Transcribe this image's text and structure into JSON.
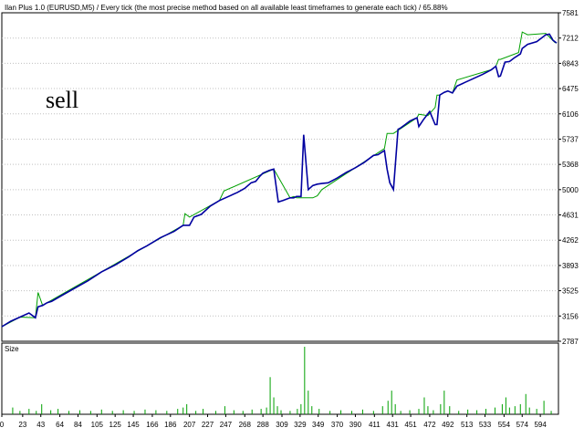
{
  "header": {
    "title": "Ilan Plus 1.0 (EURUSD,M5) / Every tick (the most precise method based on all available least timeframes to generate each tick) / 65.88%"
  },
  "overlay": {
    "label": "sell"
  },
  "size_panel": {
    "label": "Size"
  },
  "colors": {
    "balance": "#0000A0",
    "equity": "#00A000",
    "volume": "#00A000",
    "grid": "#C0C0C0"
  },
  "chart_data": [
    {
      "type": "line",
      "title": "",
      "xlabel": "",
      "ylabel": "",
      "y_ticks": [
        7581,
        7212,
        6843,
        6475,
        6106,
        5737,
        5368,
        5000,
        4631,
        4262,
        3893,
        3525,
        3156,
        2787
      ],
      "ylim": [
        2787,
        7581
      ],
      "xlim": [
        0,
        614
      ],
      "grid": true,
      "series": [
        {
          "role": "balance",
          "x": [
            0,
            10,
            20,
            30,
            37,
            40,
            45,
            50,
            55,
            64,
            80,
            95,
            110,
            125,
            140,
            150,
            160,
            175,
            190,
            200,
            207,
            212,
            220,
            230,
            240,
            250,
            260,
            268,
            275,
            280,
            285,
            288,
            295,
            300,
            305,
            310,
            318,
            322,
            325,
            330,
            333,
            338,
            343,
            348,
            353,
            360,
            370,
            380,
            390,
            400,
            410,
            415,
            422,
            425,
            428,
            432,
            437,
            440,
            445,
            450,
            458,
            460,
            465,
            472,
            478,
            480,
            483,
            488,
            492,
            497,
            502,
            510,
            520,
            530,
            540,
            545,
            548,
            550,
            555,
            560,
            565,
            572,
            574,
            580,
            590,
            600,
            604,
            608,
            612
          ],
          "y": [
            3000,
            3080,
            3140,
            3200,
            3130,
            3290,
            3310,
            3350,
            3370,
            3440,
            3560,
            3670,
            3800,
            3900,
            4020,
            4110,
            4180,
            4300,
            4390,
            4480,
            4480,
            4600,
            4640,
            4760,
            4840,
            4900,
            4960,
            5020,
            5100,
            5120,
            5200,
            5240,
            5280,
            5300,
            4820,
            4840,
            4880,
            4880,
            4900,
            4900,
            5800,
            5000,
            5060,
            5080,
            5090,
            5100,
            5170,
            5250,
            5320,
            5400,
            5500,
            5510,
            5570,
            5300,
            5100,
            5000,
            5880,
            5900,
            5950,
            6000,
            6050,
            5920,
            6020,
            6140,
            5950,
            5950,
            6380,
            6420,
            6440,
            6410,
            6510,
            6560,
            6620,
            6680,
            6750,
            6800,
            6650,
            6660,
            6860,
            6870,
            6920,
            6980,
            7060,
            7120,
            7160,
            7260,
            7270,
            7180,
            7140
          ]
        },
        {
          "role": "equity",
          "x": [
            0,
            20,
            37,
            40,
            45,
            50,
            200,
            202,
            207,
            240,
            245,
            300,
            318,
            322,
            325,
            343,
            348,
            353,
            422,
            425,
            428,
            432,
            458,
            460,
            470,
            478,
            480,
            483,
            488,
            492,
            497,
            502,
            540,
            545,
            548,
            550,
            570,
            574,
            580,
            600,
            610,
            612
          ],
          "y": [
            3000,
            3140,
            3130,
            3500,
            3310,
            3350,
            4480,
            4650,
            4600,
            4840,
            4980,
            5300,
            4880,
            4900,
            4880,
            4880,
            4910,
            5000,
            5600,
            5820,
            5820,
            5820,
            6050,
            6100,
            6080,
            6200,
            6380,
            6380,
            6420,
            6440,
            6410,
            6600,
            6750,
            6800,
            6900,
            6900,
            7000,
            7300,
            7260,
            7280,
            7150,
            7140
          ]
        }
      ]
    },
    {
      "type": "bar",
      "title": "Size",
      "x_ticks": [
        0,
        23,
        43,
        64,
        84,
        105,
        125,
        145,
        166,
        186,
        207,
        227,
        247,
        268,
        288,
        309,
        329,
        349,
        370,
        390,
        411,
        431,
        451,
        472,
        492,
        513,
        533,
        554,
        574,
        594
      ],
      "xlim": [
        0,
        614
      ],
      "series": [
        {
          "name": "",
          "x": [
            12,
            20,
            30,
            38,
            44,
            54,
            62,
            74,
            86,
            98,
            110,
            122,
            134,
            146,
            158,
            170,
            182,
            194,
            200,
            204,
            214,
            222,
            236,
            246,
            256,
            266,
            276,
            286,
            292,
            296,
            300,
            304,
            308,
            318,
            326,
            330,
            334,
            338,
            342,
            350,
            362,
            374,
            386,
            398,
            410,
            420,
            426,
            430,
            434,
            440,
            450,
            460,
            466,
            470,
            476,
            484,
            488,
            494,
            504,
            514,
            524,
            534,
            544,
            552,
            556,
            560,
            566,
            572,
            578,
            582,
            590,
            598,
            606
          ],
          "values": [
            0.1,
            0.05,
            0.08,
            0.05,
            0.15,
            0.06,
            0.08,
            0.05,
            0.06,
            0.05,
            0.07,
            0.05,
            0.06,
            0.05,
            0.07,
            0.06,
            0.05,
            0.08,
            0.1,
            0.15,
            0.05,
            0.08,
            0.05,
            0.12,
            0.06,
            0.05,
            0.07,
            0.08,
            0.1,
            0.55,
            0.25,
            0.12,
            0.06,
            0.05,
            0.08,
            0.15,
            1.0,
            0.35,
            0.12,
            0.08,
            0.05,
            0.06,
            0.05,
            0.07,
            0.05,
            0.12,
            0.2,
            0.35,
            0.15,
            0.05,
            0.06,
            0.08,
            0.25,
            0.12,
            0.06,
            0.15,
            0.35,
            0.12,
            0.05,
            0.07,
            0.06,
            0.08,
            0.1,
            0.15,
            0.25,
            0.1,
            0.12,
            0.15,
            0.3,
            0.1,
            0.08,
            0.2,
            0.05
          ]
        }
      ]
    }
  ]
}
